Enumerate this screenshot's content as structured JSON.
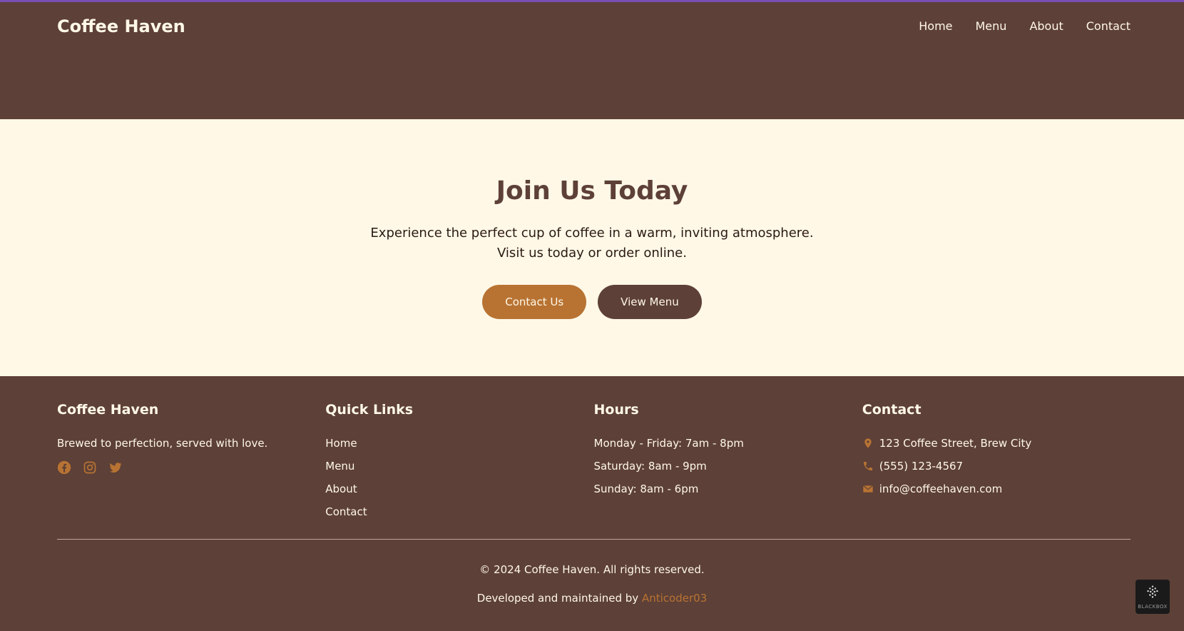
{
  "header": {
    "brand": "Coffee Haven",
    "nav": [
      "Home",
      "Menu",
      "About",
      "Contact"
    ]
  },
  "hero": {
    "title": "Join Us Today",
    "text": "Experience the perfect cup of coffee in a warm, inviting atmosphere. Visit us today or order online.",
    "primary_button": "Contact Us",
    "secondary_button": "View Menu"
  },
  "footer": {
    "about": {
      "heading": "Coffee Haven",
      "tagline": "Brewed to perfection, served with love.",
      "social": [
        "facebook-icon",
        "instagram-icon",
        "twitter-icon"
      ]
    },
    "quick_links": {
      "heading": "Quick Links",
      "links": [
        "Home",
        "Menu",
        "About",
        "Contact"
      ]
    },
    "hours": {
      "heading": "Hours",
      "lines": [
        "Monday - Friday: 7am - 8pm",
        "Saturday: 8am - 9pm",
        "Sunday: 8am - 6pm"
      ]
    },
    "contact": {
      "heading": "Contact",
      "address": "123 Coffee Street, Brew City",
      "phone": "(555) 123-4567",
      "email": "info@coffeehaven.com"
    },
    "copyright": "© 2024 Coffee Haven. All rights reserved.",
    "developed_prefix": "Developed and maintained by ",
    "developer": "Anticoder03"
  },
  "badge": {
    "label": "BLACKBOX"
  },
  "colors": {
    "brown": "#5d4037",
    "cream": "#fff8e7",
    "accent": "#b87333"
  }
}
